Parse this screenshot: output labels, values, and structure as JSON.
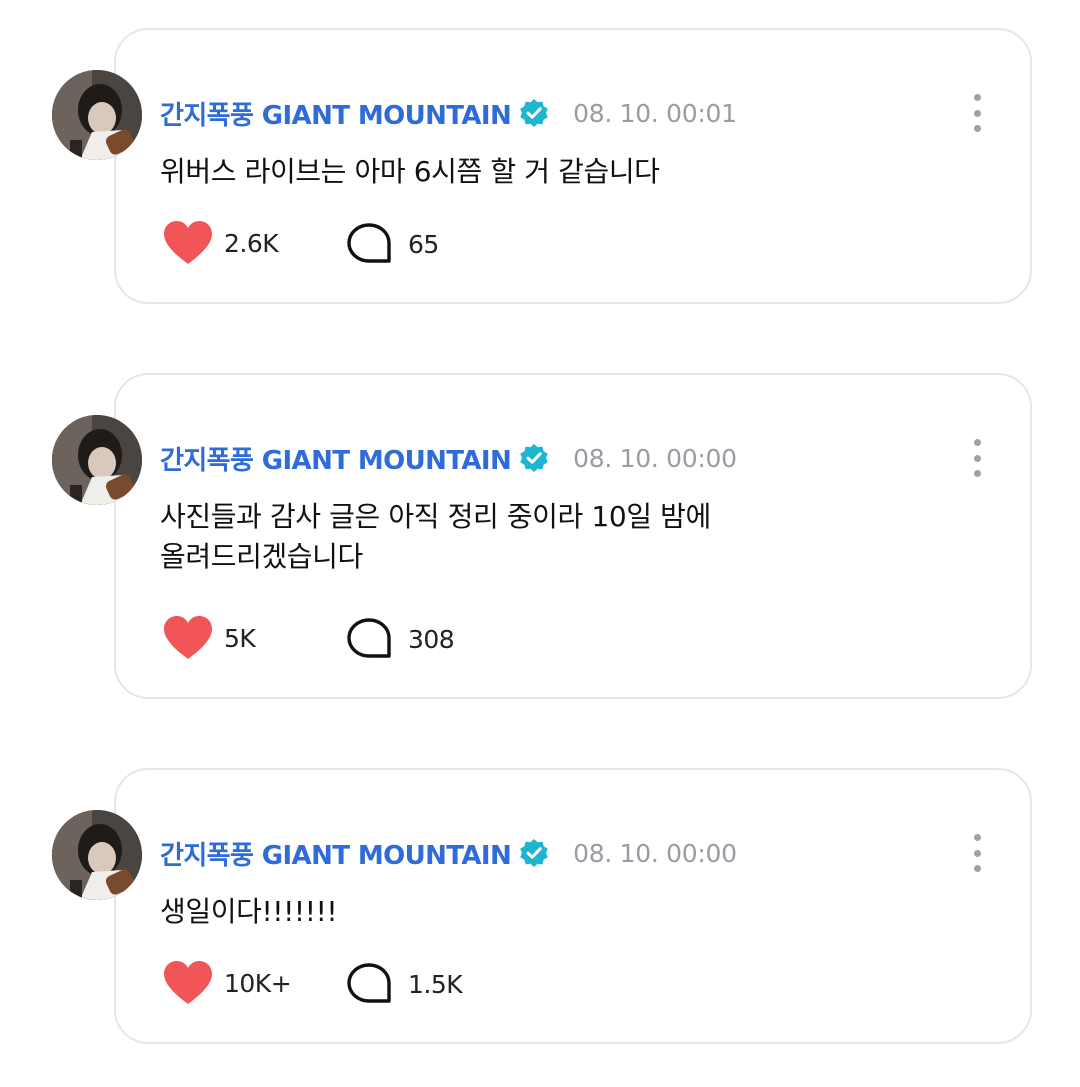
{
  "colors": {
    "author": "#2f6bd9",
    "verified_badge": "#1fb5d1",
    "like_heart": "#f25557",
    "meta": "#9a9ca3",
    "card_border": "#e6e6ea"
  },
  "icons": {
    "badge": "verified-badge-icon",
    "like": "heart-icon",
    "comment": "comment-bubble-icon",
    "more": "more-vertical-icon"
  },
  "posts": [
    {
      "author": "간지폭풍 GIANT MOUNTAIN",
      "timestamp": "08. 10. 00:01",
      "text": "위버스 라이브는 아마 6시쯤 할 거 같습니다",
      "likes": "2.6K",
      "comments": "65"
    },
    {
      "author": "간지폭풍 GIANT MOUNTAIN",
      "timestamp": "08. 10. 00:00",
      "text": "사진들과 감사 글은 아직 정리 중이라 10일 밤에\n올려드리겠습니다",
      "likes": "5K",
      "comments": "308"
    },
    {
      "author": "간지폭풍 GIANT MOUNTAIN",
      "timestamp": "08. 10. 00:00",
      "text": "생일이다!!!!!!!",
      "likes": "10K+",
      "comments": "1.5K"
    }
  ]
}
